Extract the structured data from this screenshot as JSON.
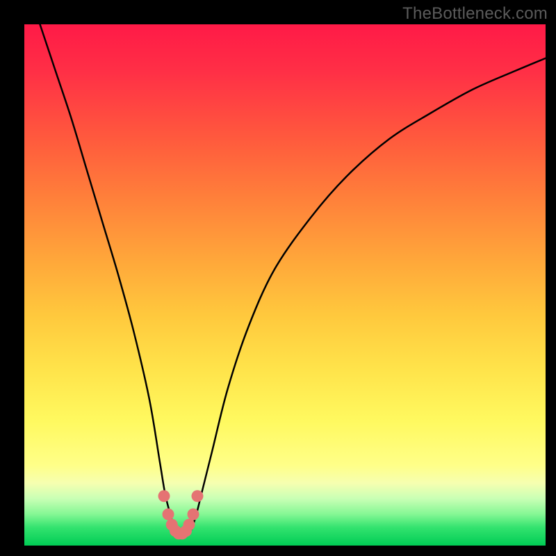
{
  "watermark": "TheBottleneck.com",
  "chart_data": {
    "type": "line",
    "title": "",
    "xlabel": "",
    "ylabel": "",
    "xlim": [
      0,
      100
    ],
    "ylim": [
      0,
      100
    ],
    "series": [
      {
        "name": "bottleneck-curve",
        "x": [
          3,
          6,
          9,
          12,
          15,
          18,
          21,
          24,
          26,
          27,
          28,
          29,
          30,
          31,
          32,
          33,
          34,
          36,
          39,
          43,
          48,
          55,
          62,
          70,
          78,
          86,
          94,
          100
        ],
        "y": [
          100,
          91,
          82,
          72,
          62,
          52,
          41,
          28,
          16,
          10,
          6,
          3,
          2.2,
          2.2,
          3,
          6,
          10,
          18,
          30,
          42,
          53,
          63,
          71,
          78,
          83,
          87.5,
          91,
          93.5
        ]
      },
      {
        "name": "bottleneck-markers",
        "x": [
          26.8,
          27.6,
          28.3,
          29.0,
          29.6,
          30.3,
          31.0,
          31.6,
          32.4,
          33.2
        ],
        "y": [
          9.5,
          6.0,
          4.0,
          2.8,
          2.3,
          2.3,
          2.8,
          4.0,
          6.0,
          9.5
        ]
      }
    ],
    "gradient_stops": [
      {
        "pos": 0,
        "color": "#ff1a47"
      },
      {
        "pos": 50,
        "color": "#ffb63a"
      },
      {
        "pos": 80,
        "color": "#ffff70"
      },
      {
        "pos": 100,
        "color": "#00cc55"
      }
    ]
  }
}
